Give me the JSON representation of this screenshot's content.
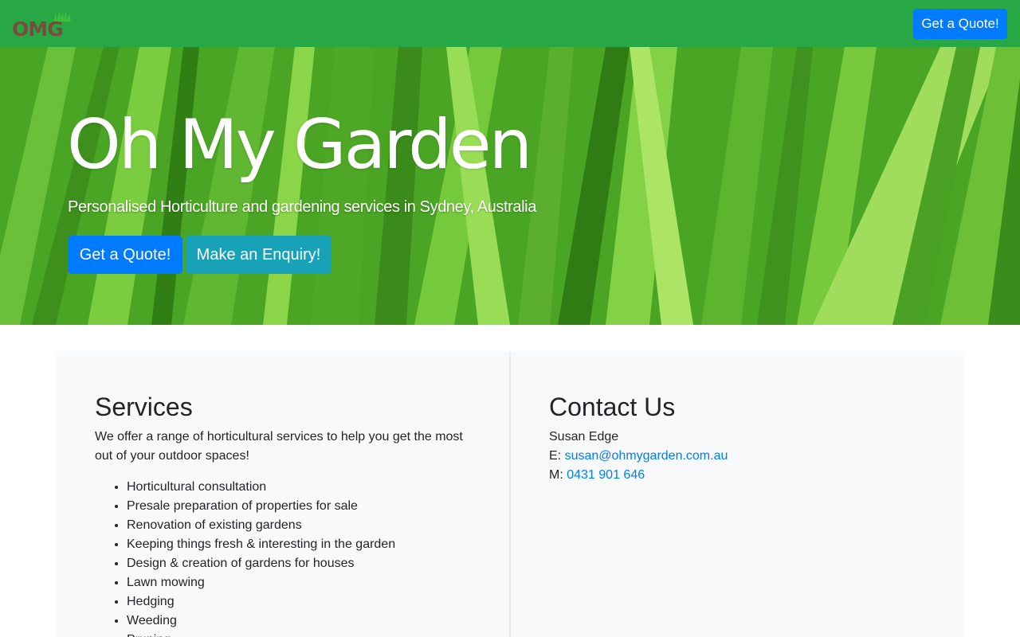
{
  "navbar": {
    "logo_text": "OMG",
    "quote_button": "Get a Quote!",
    "bg_color": "#28a745"
  },
  "hero": {
    "title": "Oh My Garden",
    "subtitle": "Personalised Horticulture and gardening services in Sydney, Australia",
    "quote_button": "Get a Quote!",
    "enquiry_button": "Make an Enquiry!"
  },
  "services": {
    "heading": "Services",
    "intro": "We offer a range of horticultural services to help you get the most out of your outdoor spaces!",
    "items": [
      "Horticultural consultation",
      "Presale preparation of properties for sale",
      "Renovation of existing gardens",
      "Keeping things fresh & interesting in the garden",
      "Design & creation of gardens for houses",
      "Lawn mowing",
      "Hedging",
      "Weeding",
      "Pruning"
    ]
  },
  "contact": {
    "heading": "Contact Us",
    "name": "Susan Edge",
    "email_label": "E:",
    "email": "susan@ohmygarden.com.au",
    "phone_label": "M:",
    "phone": "0431 901 646"
  },
  "colors": {
    "primary": "#007bff",
    "info": "#17a2b8",
    "success": "#28a745",
    "panel_bg": "#f8f9fa"
  }
}
